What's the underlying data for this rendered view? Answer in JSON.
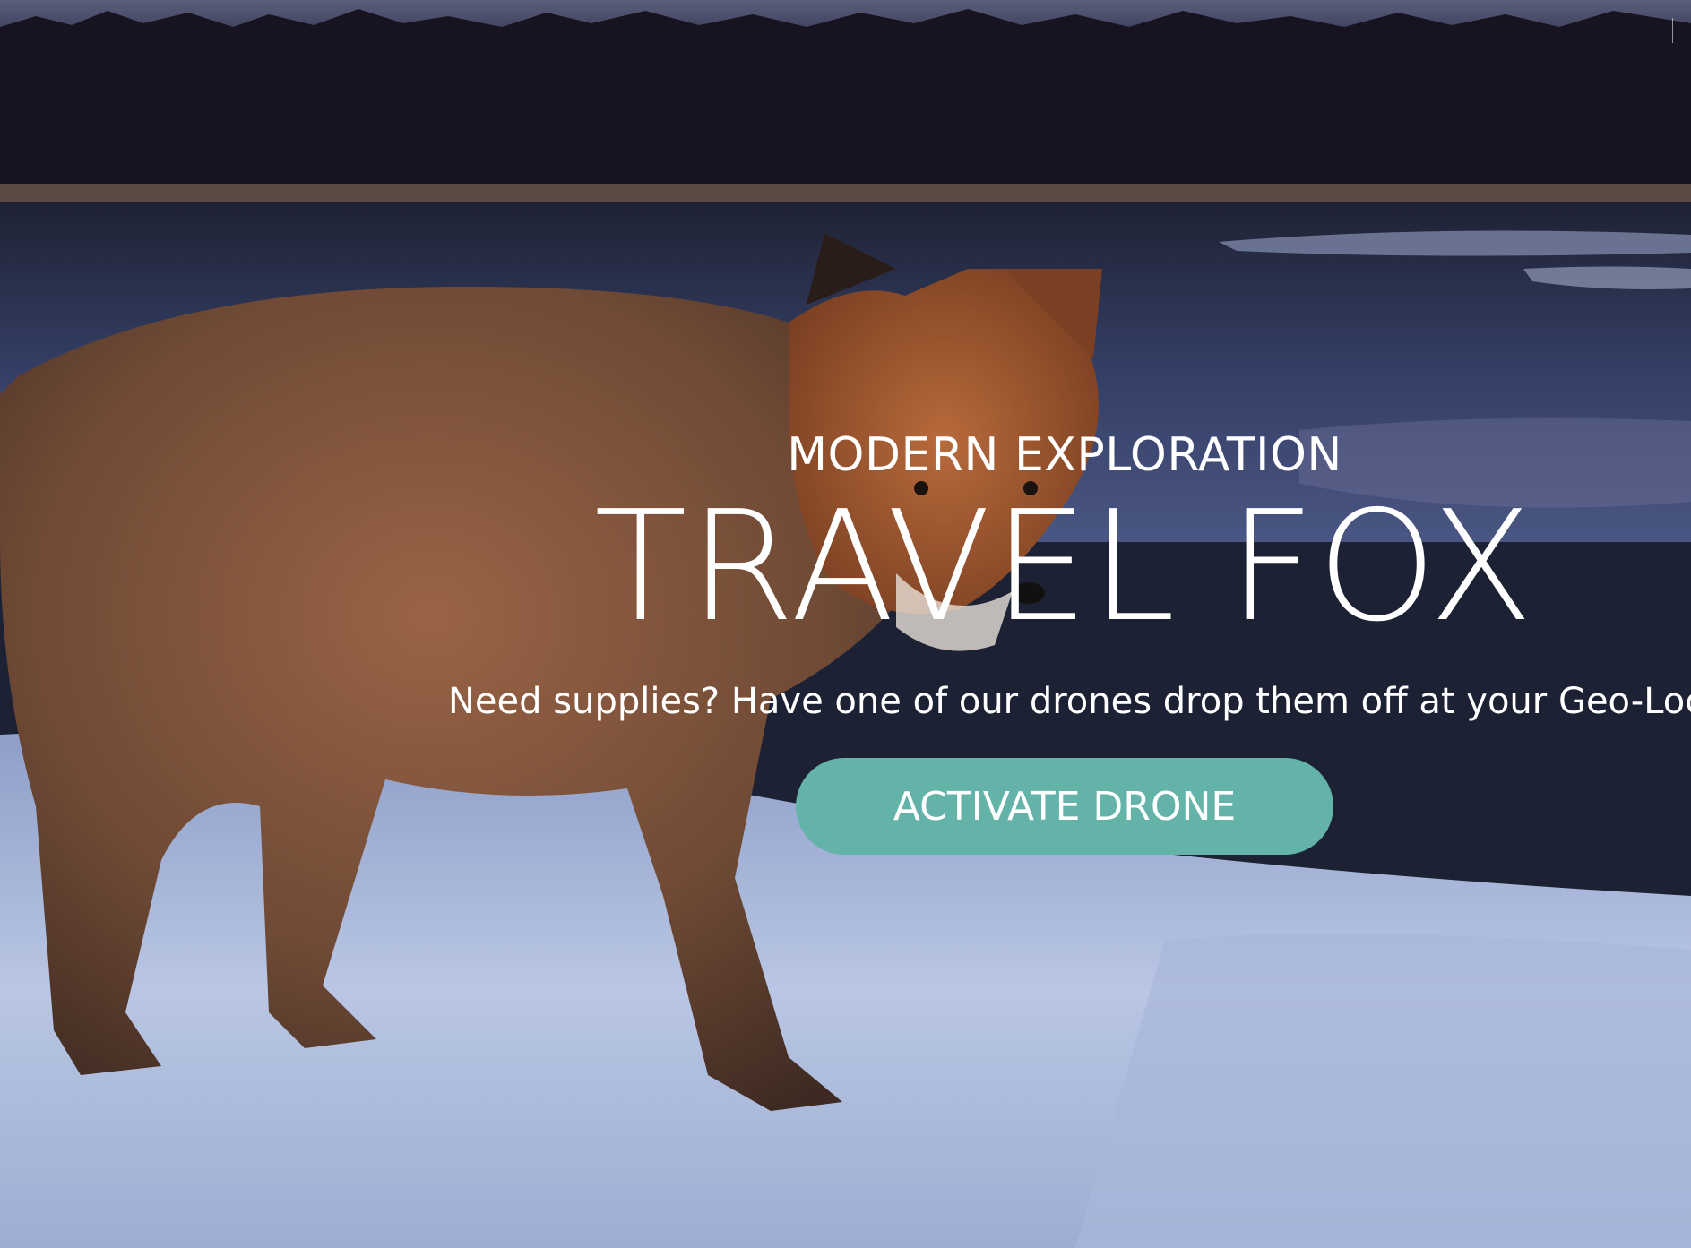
{
  "hero": {
    "eyebrow": "MODERN EXPLORATION",
    "title": "TRAVEL FOX",
    "tagline": "Need supplies? Have one of our drones drop them off at your Geo-Location",
    "cta_label": "ACTIVATE DRONE"
  },
  "colors": {
    "cta_background": "#63b3a8",
    "text": "#ffffff"
  }
}
